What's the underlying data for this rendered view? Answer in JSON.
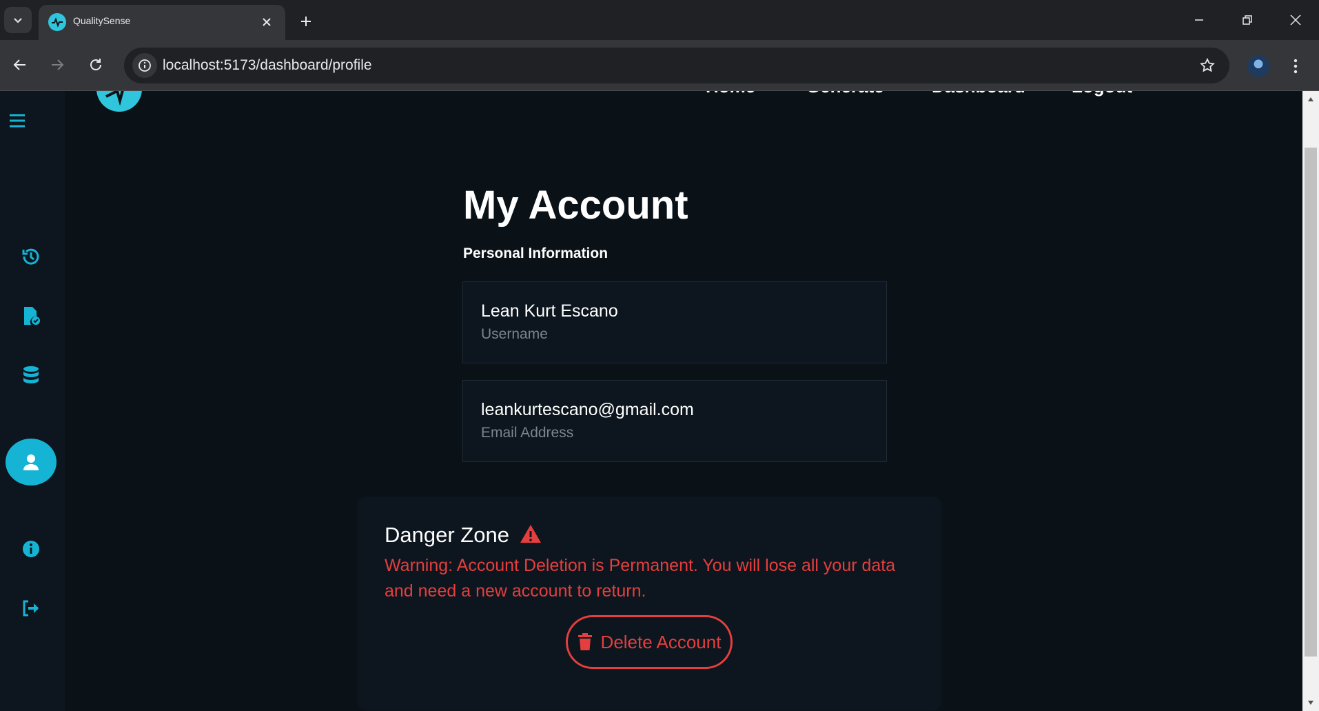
{
  "browser": {
    "tab_title": "QualitySense",
    "url": "localhost:5173/dashboard/profile"
  },
  "topnav": {
    "home": "Home",
    "generate": "Generate",
    "dashboard": "Dashboard",
    "logout": "Logout"
  },
  "sidebar": {
    "items": [
      {
        "icon": "history-icon",
        "active": false
      },
      {
        "icon": "file-check-icon",
        "active": false
      },
      {
        "icon": "database-icon",
        "active": false
      },
      {
        "icon": "user-icon",
        "active": true
      },
      {
        "icon": "info-icon",
        "active": false
      },
      {
        "icon": "sign-out-icon",
        "active": false
      }
    ]
  },
  "account": {
    "title": "My Account",
    "section": "Personal Information",
    "username_value": "Lean Kurt Escano",
    "username_label": "Username",
    "email_value": "leankurtescano@gmail.com",
    "email_label": "Email Address"
  },
  "danger": {
    "title": "Danger Zone",
    "warning": "Warning: Account Deletion is Permanent. You will lose all your data and need a new account to return.",
    "button": "Delete Account"
  },
  "colors": {
    "accent": "#16b4d4",
    "danger": "#e53e3e",
    "background": "#0a1117"
  }
}
